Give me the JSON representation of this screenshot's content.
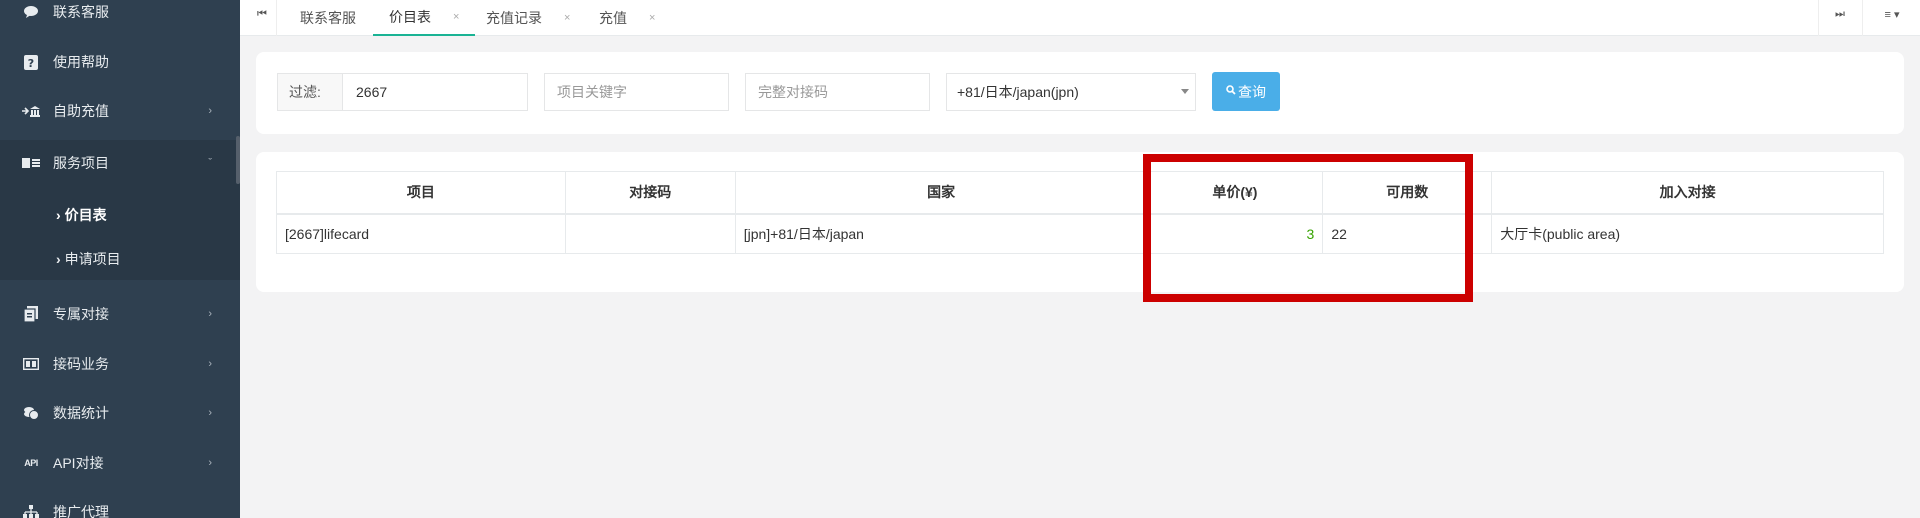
{
  "sidebar": {
    "items": [
      {
        "label": "联系客服",
        "icon": "chat-bubble-icon"
      },
      {
        "label": "使用帮助",
        "icon": "help-square-icon"
      },
      {
        "label": "自助充值",
        "icon": "bank-icon"
      },
      {
        "label": "服务项目",
        "icon": "card-list-icon"
      },
      {
        "label": "专属对接",
        "icon": "document-icon"
      },
      {
        "label": "接码业务",
        "icon": "sim-card-icon"
      },
      {
        "label": "数据统计",
        "icon": "coins-icon"
      },
      {
        "label": "API对接",
        "icon": "api-icon",
        "icon_text": "API"
      },
      {
        "label": "推广代理",
        "icon": "network-icon"
      }
    ],
    "sub_items": [
      {
        "label": "价目表"
      },
      {
        "label": "申请项目"
      }
    ]
  },
  "tabs": {
    "items": [
      {
        "label": "联系客服"
      },
      {
        "label": "价目表"
      },
      {
        "label": "充值记录"
      },
      {
        "label": "充值"
      }
    ]
  },
  "filter": {
    "label": "过滤:",
    "value": "2667",
    "keyword_placeholder": "项目关键字",
    "code_placeholder": "完整对接码",
    "country_selected": "+81/日本/japan(jpn)",
    "query_button": "查询"
  },
  "table": {
    "headers": [
      "项目",
      "对接码",
      "国家",
      "单价(¥)",
      "可用数",
      "加入对接"
    ],
    "rows": [
      {
        "project": "[2667]lifecard",
        "code": "",
        "country": "[jpn]+81/日本/japan",
        "price": "3",
        "available": "22",
        "join": "大厅卡(public area)"
      }
    ]
  },
  "colors": {
    "sidebar_bg": "#2f4050",
    "accent": "#1ab394",
    "query_button": "#4aaee8",
    "price_text": "#36a300",
    "highlight_border": "#cc0000"
  }
}
